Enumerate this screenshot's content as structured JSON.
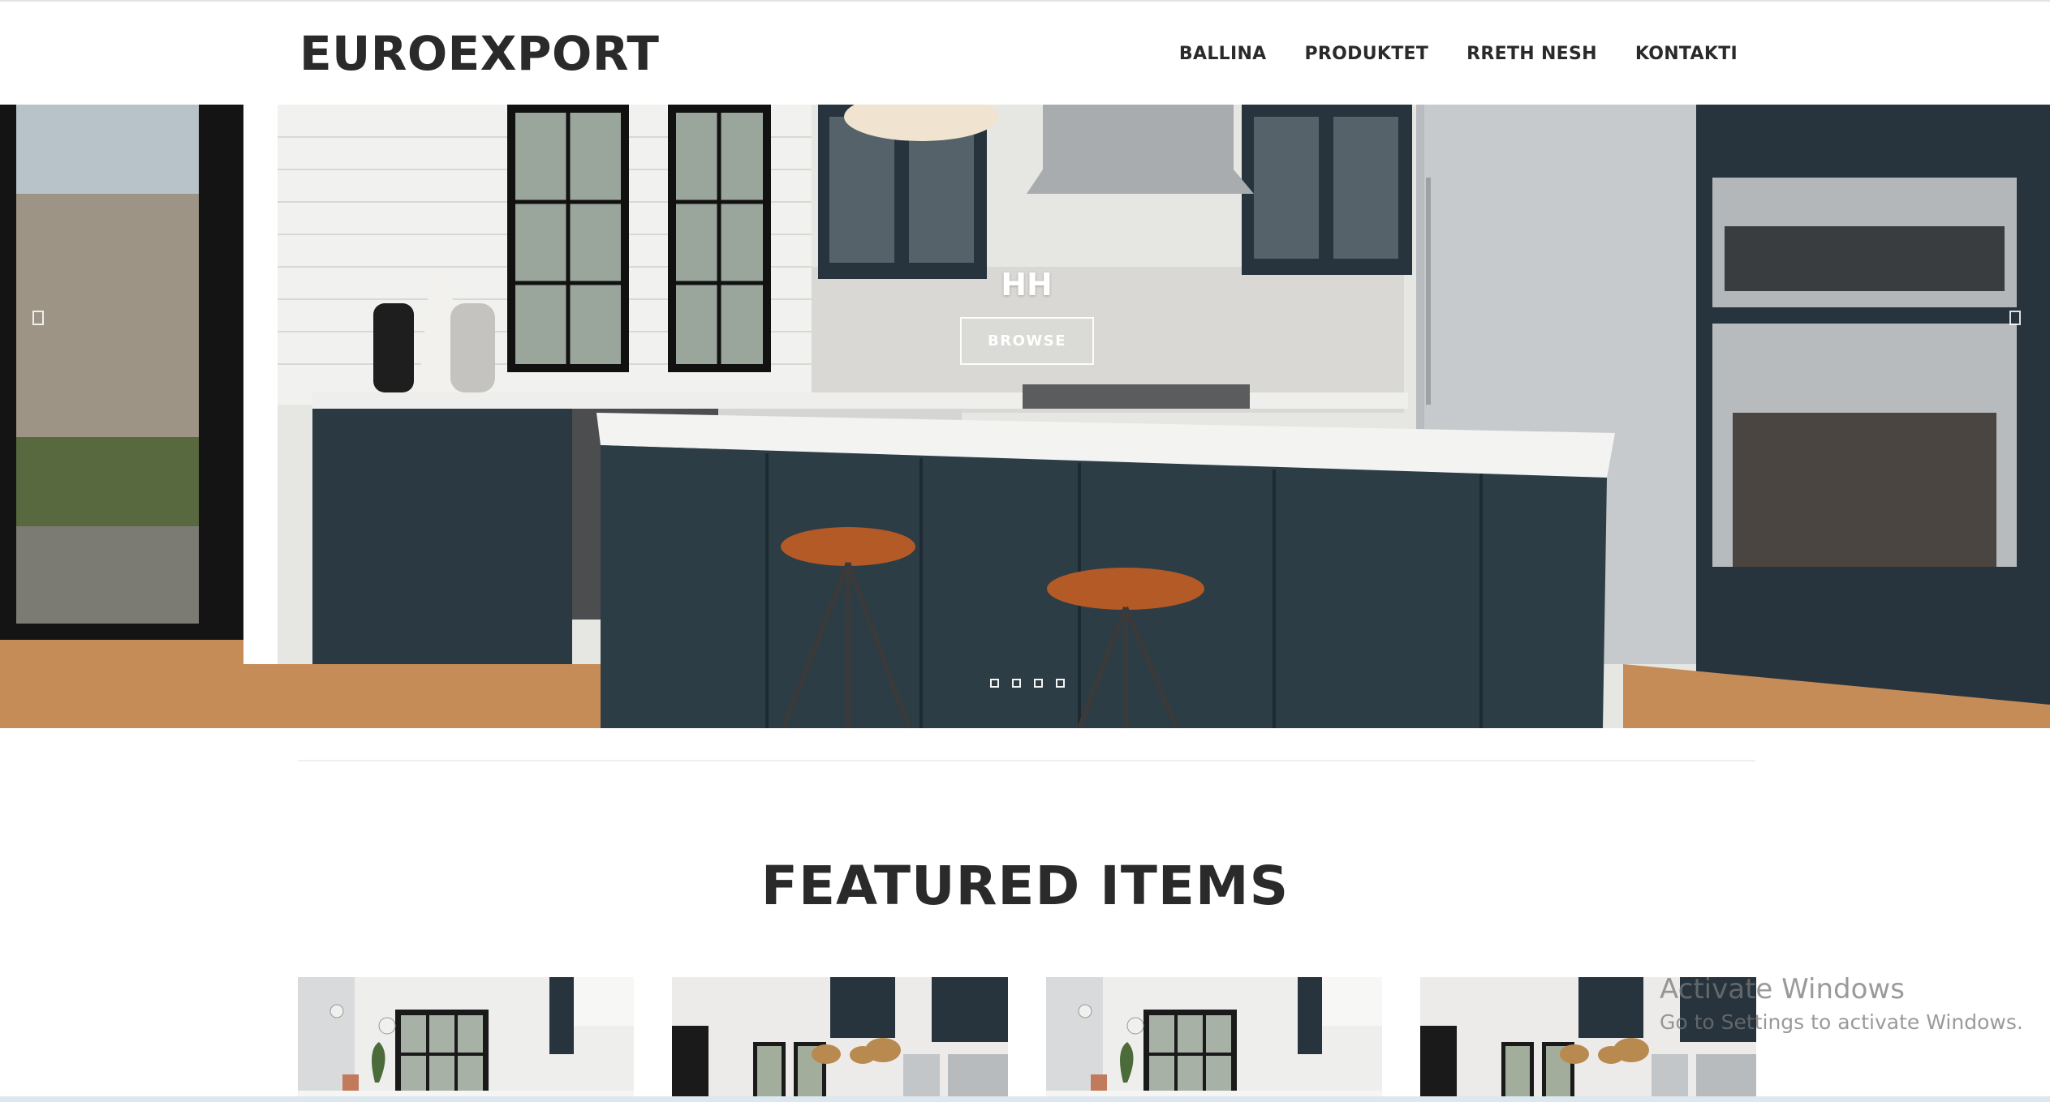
{
  "header": {
    "logo": "EUROEXPORT",
    "nav": [
      "BALLINA",
      "PRODUKTET",
      "RRETH NESH",
      "KONTAKTI"
    ]
  },
  "hero": {
    "title": "HH",
    "button_label": "BROWSE",
    "slide_count": 4
  },
  "featured": {
    "title": "FEATURED ITEMS",
    "items": [
      {
        "image": "bright-kitchen-photo"
      },
      {
        "image": "dark-cabinet-kitchen-photo"
      },
      {
        "image": "bright-kitchen-photo"
      },
      {
        "image": "dark-cabinet-kitchen-photo"
      }
    ]
  },
  "watermark": {
    "title": "Activate Windows",
    "subtitle": "Go to Settings to activate Windows."
  },
  "colors": {
    "text_dark": "#2a2a2a",
    "cabinet_navy": "#27343d",
    "wood_floor": "#c58c58",
    "white": "#ffffff"
  }
}
